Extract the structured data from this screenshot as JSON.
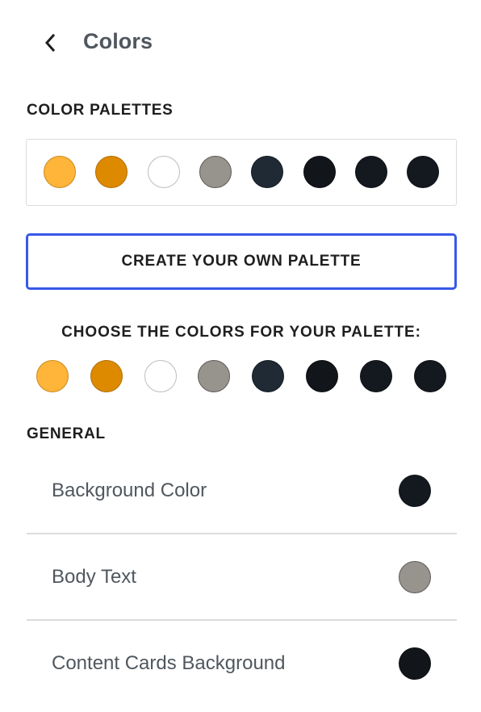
{
  "header": {
    "back_icon": "chevron-left-icon",
    "title": "Colors"
  },
  "palettes": {
    "label": "Color Palettes",
    "swatches": [
      "#ffb43a",
      "#de8a00",
      "#ffffff",
      "#97938d",
      "#1f2a35",
      "#121519",
      "#141920",
      "#141920"
    ]
  },
  "create_button": {
    "label": "CREATE YOUR OWN PALETTE",
    "border_color": "#3858e9"
  },
  "choose": {
    "label": "CHOOSE THE COLORS FOR YOUR PALETTE:",
    "swatches": [
      "#ffb43a",
      "#de8a00",
      "#ffffff",
      "#97938d",
      "#1f2a35",
      "#121519",
      "#141920",
      "#141920"
    ]
  },
  "general": {
    "label": "General",
    "items": [
      {
        "label": "Background Color",
        "color": "#141920"
      },
      {
        "label": "Body Text",
        "color": "#97938d"
      },
      {
        "label": "Content Cards Background",
        "color": "#121519"
      }
    ]
  }
}
